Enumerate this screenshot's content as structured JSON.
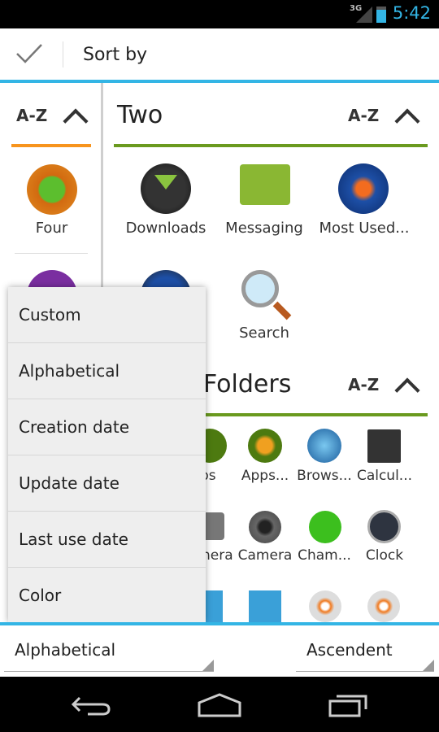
{
  "status_bar": {
    "network": "3G",
    "time": "5:42"
  },
  "action_bar": {
    "title": "Sort by",
    "confirm_icon": "check-icon"
  },
  "left_panel": {
    "sort_label": "A-Z",
    "accent": "#f7941d",
    "items": [
      {
        "label": "Four"
      }
    ]
  },
  "groups": [
    {
      "title": "Two",
      "sort_label": "A-Z",
      "accent": "#6a9a1f",
      "items": [
        {
          "label": "Downloads"
        },
        {
          "label": "Messaging"
        },
        {
          "label": "Most Used..."
        },
        {
          "label": "Search"
        }
      ]
    },
    {
      "title": "Folders",
      "sort_label": "A-Z",
      "accent": "#6a9a1f",
      "items": [
        {
          "label": "ps"
        },
        {
          "label": "Apps..."
        },
        {
          "label": "Brows..."
        },
        {
          "label": "Calcul..."
        },
        {
          "label": "nera"
        },
        {
          "label": "Camera"
        },
        {
          "label": "Cham..."
        },
        {
          "label": "Clock"
        }
      ]
    }
  ],
  "sort_menu": {
    "options": [
      "Custom",
      "Alphabetical",
      "Creation date",
      "Update date",
      "Last use date",
      "Color"
    ]
  },
  "bottom_bar": {
    "sort_field": "Alphabetical",
    "sort_order": "Ascendent"
  },
  "colors": {
    "holo_blue": "#33b5e5"
  }
}
